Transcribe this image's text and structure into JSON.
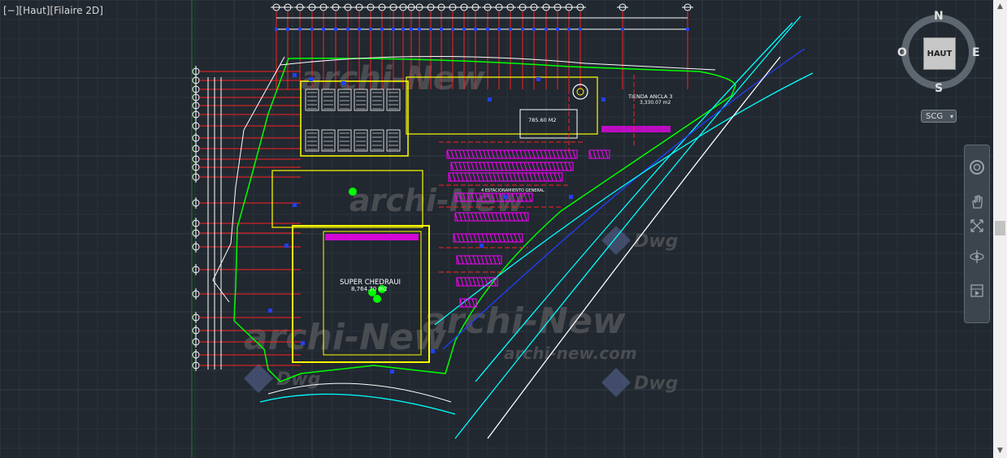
{
  "viewport": {
    "label": "[−][Haut][Filaire 2D]"
  },
  "viewcube": {
    "north": "N",
    "south": "S",
    "east": "E",
    "west": "O",
    "face": "HAUT"
  },
  "ucs": {
    "label": "SCG",
    "arrow": "▾"
  },
  "navbar": {
    "tools": [
      "steeringwheel-icon",
      "pan-icon",
      "zoom-extents-icon",
      "orbit-icon",
      "showmotion-icon"
    ]
  },
  "scrollbar": {
    "up": "▲",
    "down": "▼"
  },
  "drawing": {
    "super_name": "SUPER CHEDRAUI",
    "super_area": "8,764.70 m2",
    "tienda_name": "TIENDA ANCLA 3",
    "tienda_area": "3,330.07 m2",
    "store_area": "785.60 M2",
    "parking": "4 ESTACIONAMIENTO GENERAL",
    "watermark_text": "archi-New",
    "watermark_site": "archi-new.com",
    "watermark_logo": "Dwg"
  },
  "colors": {
    "background": "#212830",
    "grid_minor": "#2a323b",
    "grid_major": "#343d47",
    "cad_red": "#ff2020",
    "cad_yellow": "#ffff00",
    "cad_magenta": "#ff00ff",
    "cad_cyan": "#00ffff",
    "cad_green": "#00ff00",
    "cad_blue": "#2040ff",
    "cad_white": "#ffffff"
  }
}
